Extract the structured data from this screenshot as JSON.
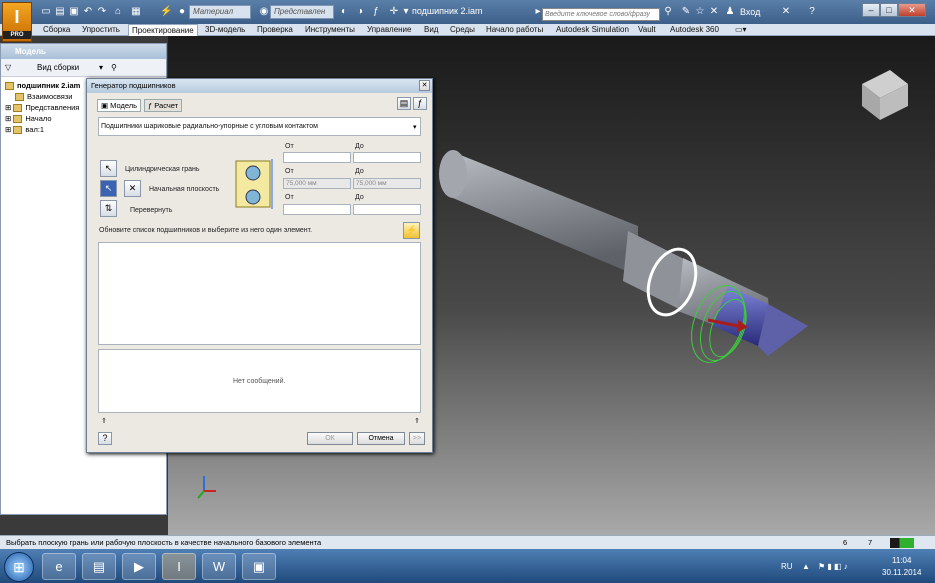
{
  "app": {
    "logo": "I",
    "logo_sub": "PRO",
    "document_title": "подшипник 2.iam",
    "material_placeholder": "Материал",
    "representation_placeholder": "Представлен",
    "search_placeholder": "Введите ключевое слово/фразу",
    "login_label": "Вход",
    "help": "?"
  },
  "ribbon": {
    "tabs": [
      {
        "label": "Сборка"
      },
      {
        "label": "Упростить"
      },
      {
        "label": "Проектирование"
      },
      {
        "label": "3D-модель"
      },
      {
        "label": "Проверка"
      },
      {
        "label": "Инструменты"
      },
      {
        "label": "Управление"
      },
      {
        "label": "Вид"
      },
      {
        "label": "Среды"
      },
      {
        "label": "Начало работы"
      },
      {
        "label": "Autodesk Simulation"
      },
      {
        "label": "Vault"
      },
      {
        "label": "Autodesk 360"
      }
    ]
  },
  "browser": {
    "title": "Модель",
    "view_label": "Вид сборки",
    "items": [
      {
        "label": "подшипник 2.iam"
      },
      {
        "label": "Взаимосвязи"
      },
      {
        "label": "Представления"
      },
      {
        "label": "Начало"
      },
      {
        "label": "вал:1"
      }
    ]
  },
  "dialog": {
    "title": "Генератор подшипников",
    "tabs": [
      {
        "label": "Модель"
      },
      {
        "label": "Расчет"
      }
    ],
    "bearing_type": "Подшипники шариковые радиально-упорные с угловым контактом",
    "cylindrical_face_label": "Цилиндрическая грань",
    "start_plane_label": "Начальная плоскость",
    "flip_label": "Перевернуть",
    "from_label": "От",
    "to_label": "До",
    "diameter_from": "75,000 мм",
    "diameter_to": "75,000 мм",
    "hint": "Обновите список подшипников и выберите из него один элемент.",
    "messages": "Нет сообщений.",
    "ok_label": "ОК",
    "cancel_label": "Отмена",
    "more_label": ">>"
  },
  "status": {
    "text": "Выбрать плоскую грань или рабочую плоскость в качестве начального базового элемента",
    "count_a": "6",
    "count_b": "7"
  },
  "taskbar": {
    "lang": "RU",
    "time": "11:04",
    "date": "30.11.2014"
  },
  "colors": {
    "accent": "#3c5f8a",
    "shaft": "#8a8e94",
    "bearing": "#3b3b9e",
    "selection": "#3ccc3c"
  }
}
